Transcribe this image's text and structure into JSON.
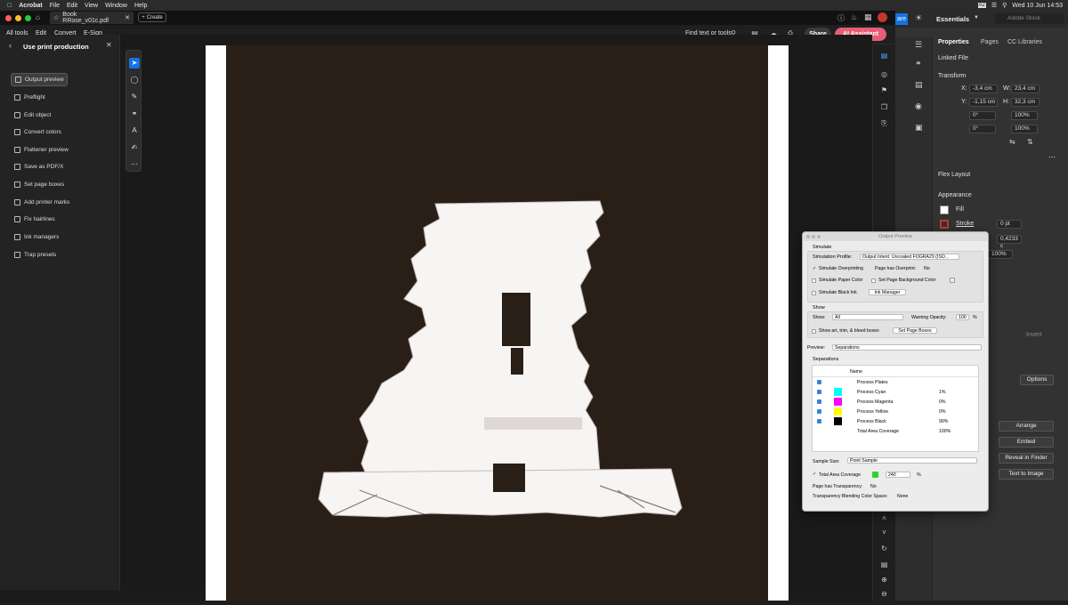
{
  "menubar": {
    "app": "Acrobat",
    "items": [
      "File",
      "Edit",
      "View",
      "Window",
      "Help"
    ],
    "datetime": "Wed 10 Jun  14:53",
    "a_icon": "A2"
  },
  "tabbar": {
    "doc_name": "Book RRose_v01c.pdf",
    "create_label": "Create"
  },
  "toolbar": {
    "menu": [
      "All tools",
      "Edit",
      "Convert",
      "E-Sign"
    ],
    "find_label": "Find text or tools",
    "share_label": "Share",
    "ai_label": "AI Assistant"
  },
  "left_panel": {
    "title": "Use print production",
    "items": [
      {
        "label": "Output preview",
        "selected": true
      },
      {
        "label": "Preflight"
      },
      {
        "label": "Edit object"
      },
      {
        "label": "Convert colors"
      },
      {
        "label": "Flattener preview"
      },
      {
        "label": "Save as PDF/X"
      },
      {
        "label": "Set page boxes"
      },
      {
        "label": "Add printer marks"
      },
      {
        "label": "Fix hairlines"
      },
      {
        "label": "Ink managers"
      },
      {
        "label": "Trap presets"
      }
    ]
  },
  "illustrator": {
    "share_label": "are",
    "workspace": "Essentials",
    "stock_placeholder": "Adobe Stock",
    "tabs": [
      "Properties",
      "Pages",
      "CC Libraries"
    ],
    "linked_file": "Linked File",
    "transform_title": "Transform",
    "x_label": "X:",
    "x_value": "-3,4 cm",
    "y_label": "Y:",
    "y_value": "-1,15 cm",
    "w_label": "W:",
    "w_value": "23,4 cm",
    "h_label": "H:",
    "h_value": "32,3 cm",
    "rotate_value": "0°",
    "shear_value": "0°",
    "scale_w": "100%",
    "scale_h": "100%",
    "flex_layout": "Flex Layout",
    "appearance": "Appearance",
    "fill_label": "Fill",
    "stroke_label": "Stroke",
    "stroke_value": "0 pt",
    "stroke_width2": "0,4233 c",
    "opacity_value": "100%",
    "invert_label": "Invert",
    "options_label": "Options",
    "arrange_label": "Arrange",
    "embed_label": "Embed",
    "reveal_label": "Reveal in Finder",
    "text_to_image_label": "Text to Image"
  },
  "output_preview": {
    "title": "Output Preview",
    "simulate_heading": "Simulate",
    "sim_profile_label": "Simulation Profile:",
    "sim_profile_value": "Output Intent: Uncoated FOGRA29 (ISO...",
    "simulate_overprinting": "Simulate Overprinting",
    "page_has_overprint_label": "Page has Overprint:",
    "page_has_overprint_value": "No",
    "simulate_paper_color": "Simulate Paper Color",
    "set_page_bg": "Set Page Background Color",
    "simulate_black_ink": "Simulate Black Ink",
    "ink_manager": "Ink Manager",
    "show_heading": "Show",
    "show_label": "Show:",
    "show_value": "All",
    "warning_opacity_label": "Warning Opacity:",
    "warning_opacity_value": "100",
    "percent": "%",
    "show_boxes": "Show art, trim, & bleed boxes",
    "set_page_boxes": "Set Page Boxes",
    "preview_label": "Preview:",
    "preview_value": "Separations",
    "separations_heading": "Separations",
    "name_col": "Name",
    "rows": [
      {
        "name": "Process Plates",
        "value": "",
        "color": "",
        "checked": true
      },
      {
        "name": "Process Cyan",
        "value": "1%",
        "color": "#00ffff",
        "checked": true
      },
      {
        "name": "Process Magenta",
        "value": "0%",
        "color": "#ff00ff",
        "checked": true
      },
      {
        "name": "Process Yellow",
        "value": "0%",
        "color": "#ffff00",
        "checked": true
      },
      {
        "name": "Process Black",
        "value": "99%",
        "color": "#000000",
        "checked": true
      },
      {
        "name": "Total Area Coverage",
        "value": "100%",
        "color": "",
        "checked": false
      }
    ],
    "sample_size_label": "Sample Size:",
    "sample_size_value": "Point Sample",
    "tac_label": "Total Area Coverage",
    "tac_value": "240",
    "tac_color": "#2fd12f",
    "page_transparency_label": "Page has Transparency:",
    "page_transparency_value": "No",
    "blend_space_label": "Transparency Blending Color Space:",
    "blend_space_value": "None"
  },
  "colors": {
    "artwork_bg": "#2a1f17",
    "ai_button": "#e85d75",
    "accent_blue": "#1473e6"
  }
}
